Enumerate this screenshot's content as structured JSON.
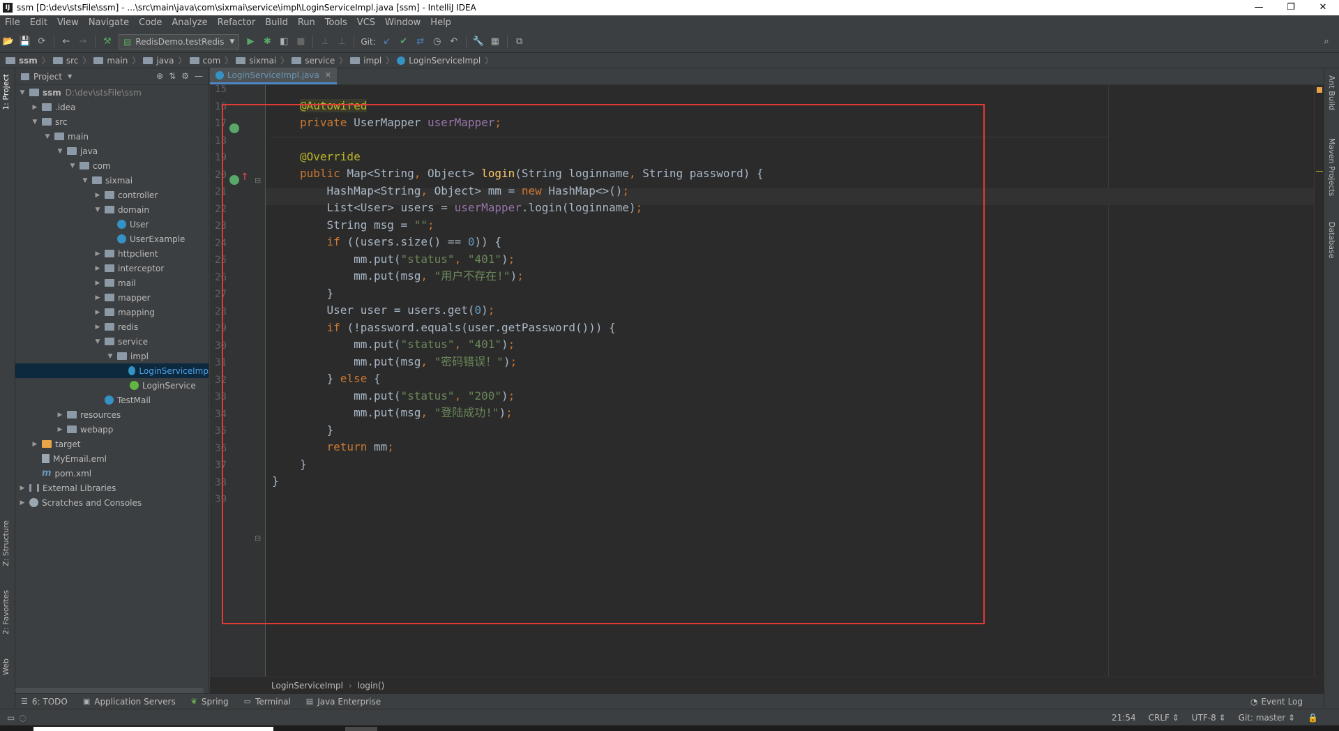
{
  "window": {
    "title": "ssm [D:\\dev\\stsFile\\ssm] - ...\\src\\main\\java\\com\\sixmai\\service\\impl\\LoginServiceImpl.java [ssm] - IntelliJ IDEA",
    "app_icon": "IJ",
    "minimize": "—",
    "restore": "❐",
    "close": "✕"
  },
  "menu": [
    "File",
    "Edit",
    "View",
    "Navigate",
    "Code",
    "Analyze",
    "Refactor",
    "Build",
    "Run",
    "Tools",
    "VCS",
    "Window",
    "Help"
  ],
  "toolbar": {
    "run_config": "RedisDemo.testRedis",
    "git_label": "Git:"
  },
  "breadcrumb": [
    "ssm",
    "src",
    "main",
    "java",
    "com",
    "sixmai",
    "service",
    "impl",
    "LoginServiceImpl"
  ],
  "left_tabs": {
    "project": "1: Project",
    "structure": "Z: Structure",
    "favorites": "2: Favorites",
    "web": "Web"
  },
  "right_tabs": {
    "ant": "Ant Build",
    "maven": "Maven Projects",
    "database": "Database"
  },
  "project_panel": {
    "title": "Project",
    "tree": [
      {
        "label": "ssm",
        "extra": "D:\\dev\\stsFile\\ssm",
        "depth": 0,
        "arrow": "▼",
        "icon": "folder",
        "bold": true
      },
      {
        "label": ".idea",
        "depth": 1,
        "arrow": "▶",
        "icon": "folder"
      },
      {
        "label": "src",
        "depth": 1,
        "arrow": "▼",
        "icon": "folder"
      },
      {
        "label": "main",
        "depth": 2,
        "arrow": "▼",
        "icon": "folder"
      },
      {
        "label": "java",
        "depth": 3,
        "arrow": "▼",
        "icon": "folder"
      },
      {
        "label": "com",
        "depth": 4,
        "arrow": "▼",
        "icon": "folder"
      },
      {
        "label": "sixmai",
        "depth": 5,
        "arrow": "▼",
        "icon": "folder"
      },
      {
        "label": "controller",
        "depth": 6,
        "arrow": "▶",
        "icon": "folder"
      },
      {
        "label": "domain",
        "depth": 6,
        "arrow": "▼",
        "icon": "folder"
      },
      {
        "label": "User",
        "depth": 7,
        "arrow": "",
        "icon": "class"
      },
      {
        "label": "UserExample",
        "depth": 7,
        "arrow": "",
        "icon": "class"
      },
      {
        "label": "httpclient",
        "depth": 6,
        "arrow": "▶",
        "icon": "folder"
      },
      {
        "label": "interceptor",
        "depth": 6,
        "arrow": "▶",
        "icon": "folder"
      },
      {
        "label": "mail",
        "depth": 6,
        "arrow": "▶",
        "icon": "folder"
      },
      {
        "label": "mapper",
        "depth": 6,
        "arrow": "▶",
        "icon": "folder"
      },
      {
        "label": "mapping",
        "depth": 6,
        "arrow": "▶",
        "icon": "folder"
      },
      {
        "label": "redis",
        "depth": 6,
        "arrow": "▶",
        "icon": "folder"
      },
      {
        "label": "service",
        "depth": 6,
        "arrow": "▼",
        "icon": "folder"
      },
      {
        "label": "impl",
        "depth": 7,
        "arrow": "▼",
        "icon": "folder"
      },
      {
        "label": "LoginServiceImp",
        "depth": 8,
        "arrow": "",
        "icon": "class",
        "selected": true
      },
      {
        "label": "LoginService",
        "depth": 8,
        "arrow": "",
        "icon": "interface"
      },
      {
        "label": "TestMail",
        "depth": 6,
        "arrow": "",
        "icon": "class"
      },
      {
        "label": "resources",
        "depth": 3,
        "arrow": "▶",
        "icon": "folder"
      },
      {
        "label": "webapp",
        "depth": 3,
        "arrow": "▶",
        "icon": "folder"
      },
      {
        "label": "target",
        "depth": 1,
        "arrow": "▶",
        "icon": "folder-orange"
      },
      {
        "label": "MyEmail.eml",
        "depth": 1,
        "arrow": "",
        "icon": "file"
      },
      {
        "label": "pom.xml",
        "depth": 1,
        "arrow": "",
        "icon": "maven"
      },
      {
        "label": "External Libraries",
        "depth": 0,
        "arrow": "▶",
        "icon": "library"
      },
      {
        "label": "Scratches and Consoles",
        "depth": 0,
        "arrow": "▶",
        "icon": "scratch"
      }
    ]
  },
  "editor": {
    "tab": "LoginServiceImpl.java",
    "line_numbers": [
      "15",
      "16",
      "17",
      "18",
      "19",
      "20",
      "21",
      "22",
      "23",
      "24",
      "25",
      "26",
      "27",
      "28",
      "29",
      "30",
      "31",
      "32",
      "33",
      "34",
      "35",
      "36",
      "37",
      "38",
      "39"
    ],
    "breadcrumb": [
      "LoginServiceImpl",
      "login()"
    ]
  },
  "tool_windows": [
    {
      "icon": "☰",
      "label": "6: TODO"
    },
    {
      "icon": "▣",
      "label": "Application Servers"
    },
    {
      "icon": "❦",
      "label": "Spring"
    },
    {
      "icon": "▭",
      "label": "Terminal"
    },
    {
      "icon": "▤",
      "label": "Java Enterprise"
    }
  ],
  "event_log": "Event Log",
  "status": {
    "position": "21:54",
    "line_sep": "CRLF ⇕",
    "encoding": "UTF-8 ⇕",
    "git": "Git: master ⇕"
  }
}
